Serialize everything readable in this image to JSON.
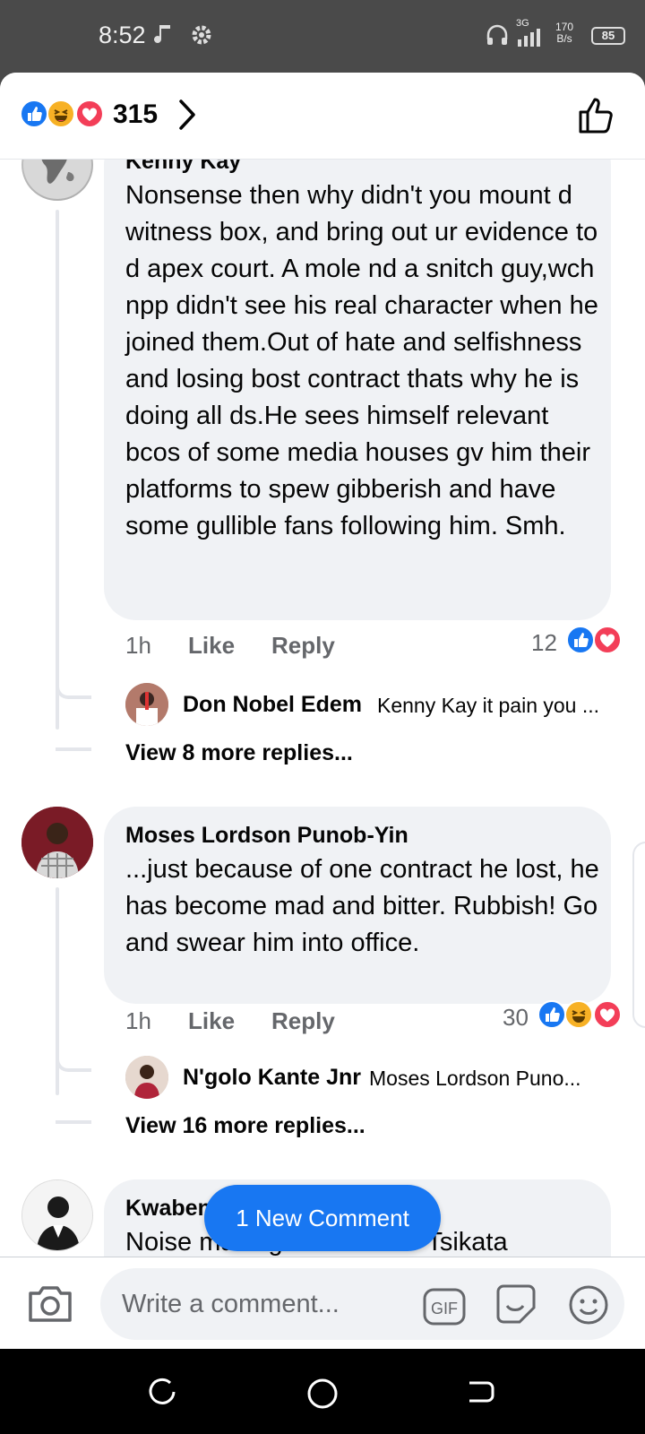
{
  "status_bar": {
    "time": "8:52",
    "signal_label": "3G",
    "net_speed_value": "170",
    "net_speed_unit": "B/s",
    "battery": "85"
  },
  "header": {
    "reaction_count": "315",
    "reaction_icons": [
      "like-icon",
      "haha-icon",
      "love-icon"
    ]
  },
  "comments": [
    {
      "author": "Kenny Kay",
      "text": "Nonsense then why didn't you mount d witness box, and bring out ur evidence  to d apex court. A mole nd a snitch guy,wch npp didn't see his real character when he joined them.Out of hate and selfishness and losing bost contract thats why he is doing all ds.He sees himself relevant bcos of some media houses gv him their platforms to spew gibberish and have some gullible fans following him. Smh.",
      "time": "1h",
      "like_label": "Like",
      "reply_label": "Reply",
      "reaction_count": "12",
      "reply_preview": {
        "author": "Don Nobel Edem",
        "snippet": "Kenny Kay it pain you ..."
      },
      "view_more": "View 8 more replies..."
    },
    {
      "author": "Moses Lordson Punob-Yin",
      "text": "...just because of one contract he lost, he has become mad and bitter. Rubbish! Go and swear him into office.",
      "time": "1h",
      "like_label": "Like",
      "reply_label": "Reply",
      "reaction_count": "30",
      "reply_preview": {
        "author": "N'golo Kante Jnr",
        "snippet": "Moses Lordson Puno..."
      },
      "view_more": "View 16 more replies..."
    },
    {
      "author": "Kwaben",
      "text": "Noise making..... even Mr Tsikata"
    }
  ],
  "new_comment_pill": "1 New Comment",
  "composer": {
    "placeholder": "Write a comment...",
    "gif_label": "GIF"
  },
  "colors": {
    "accent": "#1877f2",
    "bubble": "#f0f2f5",
    "love": "#f33e58",
    "haha": "#f7b125"
  }
}
